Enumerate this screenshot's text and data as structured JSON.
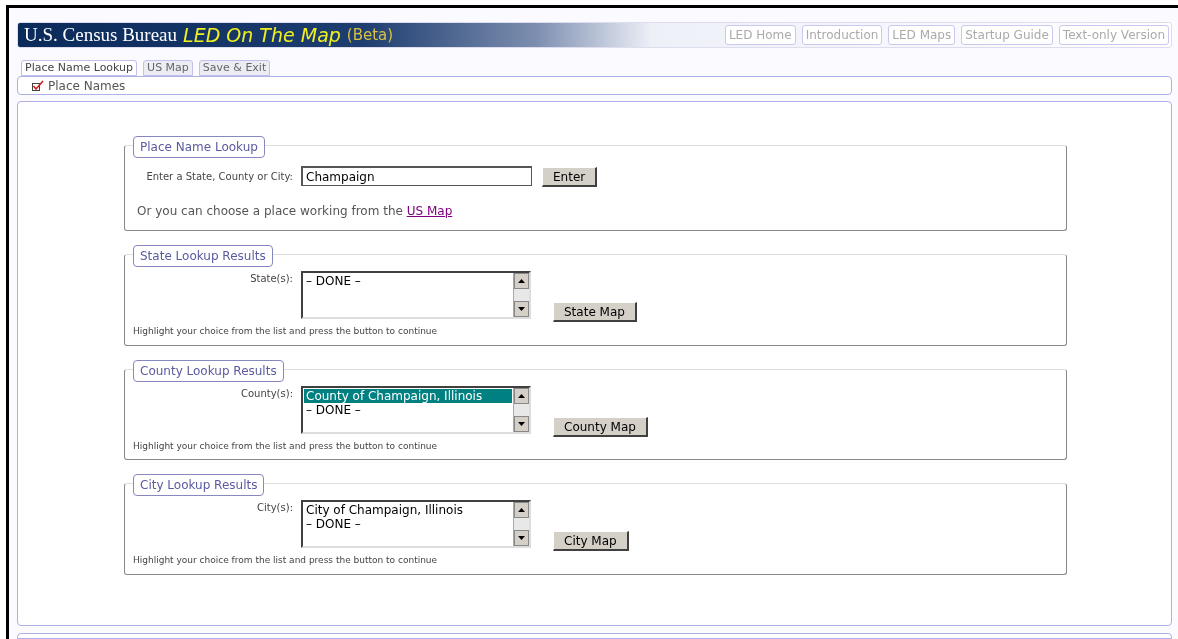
{
  "header": {
    "agency": "U.S. Census Bureau",
    "app_title": "LED On The Map",
    "beta": "(Beta)"
  },
  "nav_links": [
    "LED Home",
    "Introduction",
    "LED Maps",
    "Startup Guide",
    "Text-only Version"
  ],
  "tabs": [
    {
      "label": "Place Name Lookup",
      "selected": true
    },
    {
      "label": "US Map",
      "selected": false
    },
    {
      "label": "Save & Exit",
      "selected": false
    }
  ],
  "layer": {
    "label": "Place Names",
    "checked": true
  },
  "sections": [
    {
      "kind": "search",
      "legend": "Place Name Lookup",
      "field_label": "Enter a State, County or City:",
      "value": "Champaign",
      "button": "Enter",
      "note_text": "Or you can choose a place working from the",
      "note_link": "US Map"
    },
    {
      "kind": "list",
      "legend": "State Lookup Results",
      "field_label": "State(s):",
      "options": [
        {
          "label": "– DONE –",
          "selected": false
        }
      ],
      "button": "State Map",
      "hint": "Highlight your choice from the list and press the button to continue"
    },
    {
      "kind": "list",
      "legend": "County Lookup Results",
      "field_label": "County(s):",
      "options": [
        {
          "label": "County of Champaign, Illinois",
          "selected": true
        },
        {
          "label": "– DONE –",
          "selected": false
        }
      ],
      "button": "County Map",
      "hint": "Highlight your choice from the list and press the button to continue"
    },
    {
      "kind": "list",
      "legend": "City Lookup Results",
      "field_label": "City(s):",
      "options": [
        {
          "label": "City of Champaign, Illinois",
          "selected": false
        },
        {
          "label": "– DONE –",
          "selected": false
        }
      ],
      "button": "City Map",
      "hint": "Highlight your choice from the list and press the button to continue"
    }
  ]
}
